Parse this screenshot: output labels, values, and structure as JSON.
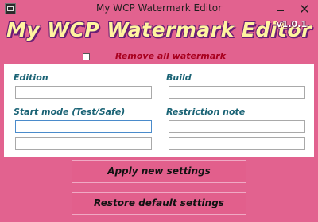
{
  "window": {
    "title": "My WCP Watermark Editor"
  },
  "header": {
    "logo_text": "My WCP Watermark Editor",
    "version": "v1.0.1"
  },
  "options": {
    "remove_all_label": "Remove all watermark",
    "remove_all_checked": false
  },
  "form": {
    "edition": {
      "label": "Edition",
      "value": ""
    },
    "build": {
      "label": "Build",
      "value": ""
    },
    "start_mode": {
      "label": "Start mode (Test/Safe)",
      "value1": "",
      "value2": ""
    },
    "restriction_note": {
      "label": "Restriction note",
      "value1": "",
      "value2": ""
    }
  },
  "actions": {
    "apply_label": "Apply new settings",
    "restore_label": "Restore default settings"
  }
}
